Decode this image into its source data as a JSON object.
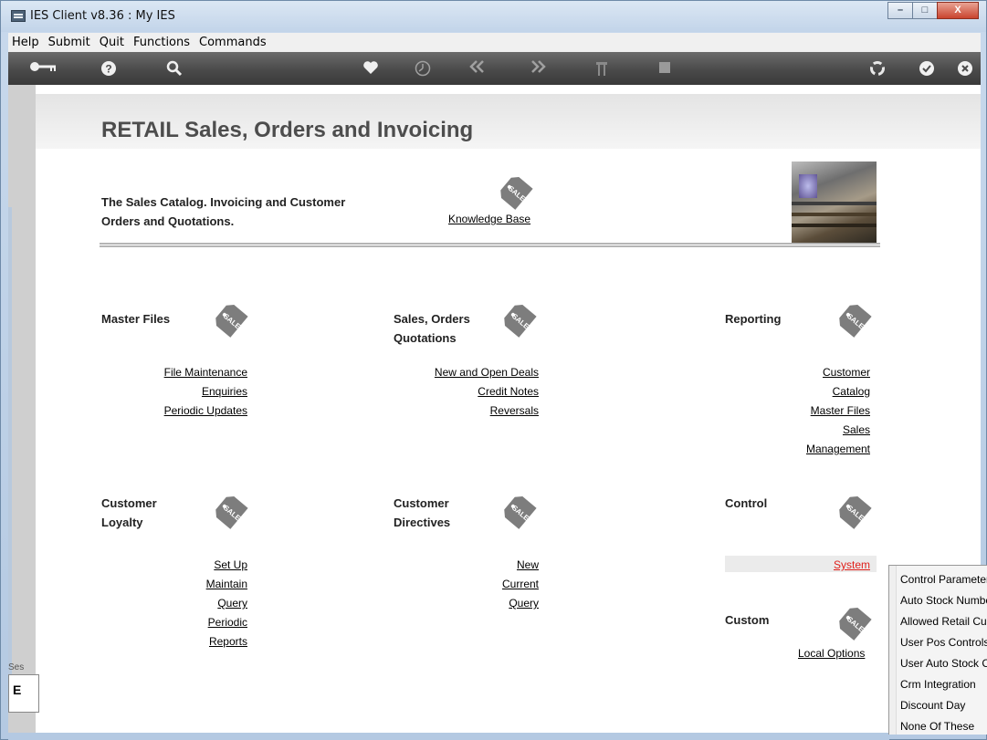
{
  "window": {
    "title": "IES Client v8.36 : My IES",
    "buttons": [
      "–",
      "□",
      "X"
    ]
  },
  "menubar": [
    "Help",
    "Submit",
    "Quit",
    "Functions",
    "Commands"
  ],
  "toolbar": {
    "icons": [
      "key-icon",
      "help-icon",
      "search-icon",
      "heart-icon",
      "clock-icon",
      "back-icon",
      "forward-icon",
      "tools-icon",
      "stop-icon",
      "recycle-icon",
      "check-icon",
      "close-icon"
    ]
  },
  "page": {
    "title": "RETAIL Sales, Orders and Invoicing",
    "intro_line1": "The Sales Catalog. Invoicing and Customer",
    "intro_line2": "Orders and Quotations.",
    "knowledge_base": "Knowledge Base"
  },
  "sections": {
    "master_files": {
      "title": "Master Files",
      "links": [
        "File Maintenance",
        "Enquiries",
        "Periodic Updates"
      ]
    },
    "sales_orders": {
      "title_line1": "Sales, Orders",
      "title_line2": "Quotations",
      "links": [
        "New and Open Deals",
        "Credit Notes",
        "Reversals"
      ]
    },
    "reporting": {
      "title": "Reporting",
      "links": [
        "Customer",
        "Catalog",
        "Master Files",
        "Sales",
        "Management"
      ]
    },
    "customer_loyalty": {
      "title_line1": "Customer",
      "title_line2": "Loyalty",
      "links": [
        "Set Up",
        "Maintain",
        "Query",
        "Periodic",
        "Reports"
      ]
    },
    "customer_directives": {
      "title_line1": "Customer",
      "title_line2": "Directives",
      "links": [
        "New",
        "Current",
        "Query"
      ]
    },
    "control": {
      "title": "Control",
      "links": [
        "System"
      ]
    },
    "custom": {
      "title": "Custom",
      "links": [
        "Local Options"
      ]
    }
  },
  "session": {
    "label": "Ses",
    "glyph": "E"
  },
  "dropdown": {
    "items": [
      "Control Parameters",
      "Auto Stock Numbering",
      "Allowed Retail Customers",
      "User Pos Controls",
      "User Auto Stock Codes",
      "Crm Integration",
      "Discount Day",
      "None Of These"
    ]
  },
  "colors": {
    "toolbar": "#4a4a4a",
    "link_active": "#e0201b",
    "title_text": "#4d4d4d"
  }
}
